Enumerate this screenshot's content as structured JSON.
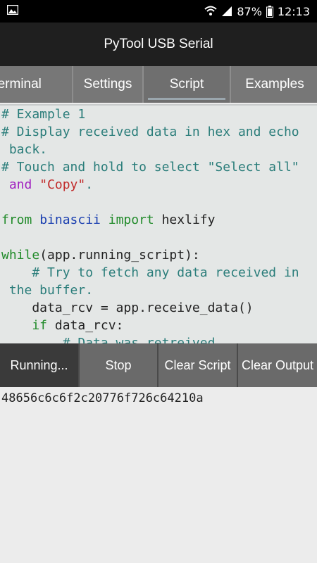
{
  "status_bar": {
    "battery": "87%",
    "time": "12:13"
  },
  "app": {
    "title": "PyTool USB Serial"
  },
  "tabs": [
    {
      "label": "Terminal"
    },
    {
      "label": "Settings"
    },
    {
      "label": "Script",
      "active": true
    },
    {
      "label": "Examples"
    }
  ],
  "script": {
    "lines": [
      [
        {
          "t": "cm",
          "v": "# Example 1"
        }
      ],
      [
        {
          "t": "cm",
          "v": "# Display received data in hex and echo"
        }
      ],
      [
        {
          "t": "cm",
          "v": " back."
        }
      ],
      [
        {
          "t": "cm",
          "v": "# Touch and hold to select \"Select all\""
        }
      ],
      [
        {
          "t": "kw2",
          "v": " and "
        },
        {
          "t": "st",
          "v": "\"Copy\""
        },
        {
          "t": "cm",
          "v": "."
        }
      ],
      [
        {
          "t": "tx",
          "v": ""
        }
      ],
      [
        {
          "t": "kw",
          "v": "from "
        },
        {
          "t": "mod",
          "v": "binascii "
        },
        {
          "t": "kw",
          "v": "import "
        },
        {
          "t": "tx",
          "v": "hexlify"
        }
      ],
      [
        {
          "t": "tx",
          "v": ""
        }
      ],
      [
        {
          "t": "kw",
          "v": "while"
        },
        {
          "t": "tx",
          "v": "(app.running_script):"
        }
      ],
      [
        {
          "t": "cm",
          "v": "    # Try to fetch any data received in"
        }
      ],
      [
        {
          "t": "cm",
          "v": " the buffer."
        }
      ],
      [
        {
          "t": "tx",
          "v": "    data_rcv = app.receive_data()"
        }
      ],
      [
        {
          "t": "kw",
          "v": "    if "
        },
        {
          "t": "tx",
          "v": "data_rcv:"
        }
      ],
      [
        {
          "t": "cm",
          "v": "        # Data was retreived"
        }
      ]
    ]
  },
  "buttons": {
    "running": "Running...",
    "stop": "Stop",
    "clear_script": "Clear Script",
    "clear_output": "Clear Output"
  },
  "output": {
    "text": "48656c6c6f2c20776f726c64210a"
  },
  "colors": {
    "comment": "#2a7d7a",
    "keyword": "#218b2a",
    "string": "#c12a2a"
  }
}
